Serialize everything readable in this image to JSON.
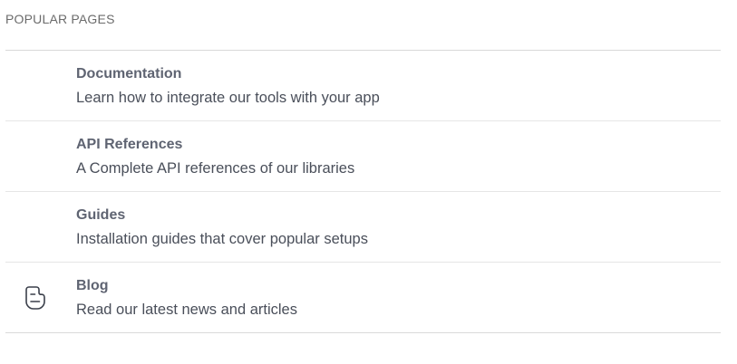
{
  "section": {
    "title": "POPULAR PAGES"
  },
  "pages": [
    {
      "title": "Documentation",
      "description": "Learn how to integrate our tools with your app",
      "icon": ""
    },
    {
      "title": "API References",
      "description": "A Complete API references of our libraries",
      "icon": ""
    },
    {
      "title": "Guides",
      "description": "Installation guides that cover popular setups",
      "icon": ""
    },
    {
      "title": "Blog",
      "description": "Read our latest news and articles",
      "icon": "blogger-icon"
    }
  ],
  "colors": {
    "title": "#5f6472",
    "description": "#4a4f5a",
    "divider": "#e6e6e6"
  }
}
